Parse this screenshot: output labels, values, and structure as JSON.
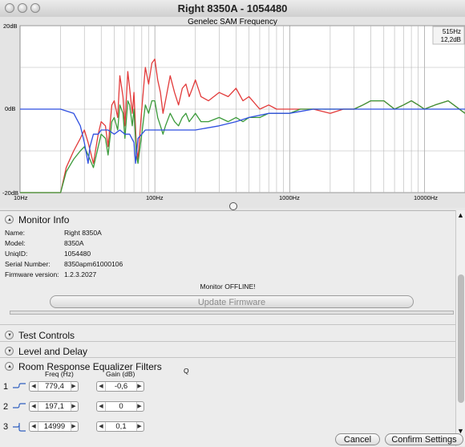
{
  "window": {
    "title": "Right 8350A - 1054480"
  },
  "chart": {
    "title": "Genelec SAM Frequency",
    "y_top_label": "20dB",
    "y_mid_label": "0dB",
    "y_bottom_label": "-20dB",
    "x_labels": [
      "10Hz",
      "100Hz",
      "1000Hz",
      "10000Hz"
    ],
    "cursor_freq": "515Hz",
    "cursor_gain": "12,2dB",
    "colors": {
      "red": "#e23a3a",
      "green": "#3a9a3a",
      "blue": "#2f4fe0",
      "brown": "#8a5a2a",
      "plot_bg": "#ffffff"
    }
  },
  "chart_data": {
    "type": "line",
    "xscale": "log",
    "xlim": [
      10,
      20000
    ],
    "ylim": [
      -20,
      20
    ],
    "x_tick_labels": [
      "10Hz",
      "100Hz",
      "1000Hz",
      "10000Hz"
    ],
    "y_tick_labels": [
      "20dB",
      "0dB",
      "-20dB"
    ],
    "series": [
      {
        "color": "red",
        "x": [
          10,
          16,
          20,
          22,
          25,
          28,
          30,
          32,
          35,
          38,
          40,
          43,
          45,
          48,
          50,
          53,
          55,
          58,
          60,
          63,
          65,
          68,
          70,
          73,
          75,
          80,
          85,
          90,
          95,
          100,
          105,
          110,
          115,
          120,
          130,
          140,
          150,
          160,
          170,
          180,
          190,
          200,
          220,
          250,
          300,
          350,
          400,
          450,
          500,
          600,
          700,
          800,
          1000,
          1200,
          1500,
          2000,
          2500,
          3000,
          3500,
          4000,
          5000,
          6000,
          7000,
          8000,
          9000,
          10000,
          12000,
          15000,
          20000
        ],
        "y": [
          -20,
          -20,
          -20,
          -14,
          -10,
          -7,
          -5,
          -8,
          -13,
          -6,
          -3,
          -4,
          -9,
          1,
          2,
          -2,
          8,
          3,
          -4,
          9,
          5,
          -1,
          4,
          -9,
          -12,
          0,
          10,
          6,
          11,
          12,
          7,
          4,
          -1,
          2,
          8,
          4,
          1,
          5,
          6,
          3,
          5,
          7,
          3,
          2,
          4,
          3,
          5,
          2,
          3,
          0,
          1,
          0,
          0,
          0,
          0,
          -1,
          0,
          0,
          1,
          2,
          2,
          0,
          1,
          2,
          1,
          0,
          1,
          2,
          -1
        ]
      },
      {
        "color": "green",
        "x": [
          10,
          16,
          20,
          22,
          25,
          28,
          30,
          32,
          35,
          38,
          40,
          43,
          45,
          48,
          50,
          53,
          55,
          58,
          60,
          63,
          65,
          68,
          70,
          73,
          75,
          80,
          85,
          90,
          95,
          100,
          105,
          110,
          115,
          120,
          130,
          140,
          150,
          160,
          170,
          180,
          190,
          200,
          220,
          250,
          300,
          350,
          400,
          450,
          500,
          600,
          700,
          800,
          1000,
          1200,
          1500,
          2000,
          2500,
          3000,
          3500,
          4000,
          5000,
          6000,
          7000,
          8000,
          9000,
          10000,
          12000,
          15000,
          20000
        ],
        "y": [
          -20,
          -20,
          -20,
          -15,
          -12,
          -10,
          -9,
          -11,
          -14,
          -9,
          -6,
          -7,
          -11,
          -3,
          -2,
          -5,
          1,
          -1,
          -7,
          2,
          1,
          -4,
          0,
          -11,
          -13,
          -6,
          1,
          -1,
          2,
          2,
          -2,
          -4,
          -6,
          -4,
          -1,
          -3,
          -4,
          -2,
          -1,
          -3,
          -2,
          -1,
          -3,
          -3,
          -2,
          -3,
          -2,
          -3,
          -2,
          -2,
          -1,
          -1,
          -1,
          0,
          0,
          0,
          0,
          0,
          1,
          2,
          2,
          0,
          1,
          2,
          1,
          0,
          1,
          2,
          -1
        ]
      },
      {
        "color": "blue",
        "x": [
          10,
          20,
          25,
          28,
          30,
          32,
          33,
          35,
          38,
          40,
          45,
          50,
          55,
          60,
          65,
          70,
          72,
          75,
          80,
          85,
          90,
          100,
          120,
          150,
          200,
          300,
          400,
          500,
          700,
          1000,
          1500,
          2000,
          3000,
          5000,
          10000,
          20000
        ],
        "y": [
          0,
          0,
          -1,
          -4,
          -8,
          -13,
          -9,
          -6,
          -6,
          -5,
          -5,
          -6,
          -5,
          -6,
          -6,
          -8,
          -13,
          -7,
          -6,
          -5,
          -5,
          -5,
          -5,
          -5,
          -5,
          -4,
          -3,
          -2,
          -1,
          -1,
          0,
          0,
          0,
          0,
          0,
          0
        ]
      }
    ]
  },
  "sections": {
    "monitor_info": "Monitor Info",
    "test_controls": "Test Controls",
    "level_delay": "Level and Delay",
    "room_eq": "Room Response Equalizer Filters"
  },
  "monitor_info": {
    "rows": [
      {
        "key": "Name:",
        "value": "Right 8350A"
      },
      {
        "key": "Model:",
        "value": "8350A"
      },
      {
        "key": "UniqID:",
        "value": "1054480"
      },
      {
        "key": "Serial Number:",
        "value": "8350apm61000106"
      },
      {
        "key": "Firmware version:",
        "value": "1.2.3.2027"
      }
    ],
    "status": "Monitor OFFLINE!",
    "update_label": "Update Firmware"
  },
  "eq": {
    "headers": {
      "freq": "Freq (Hz)",
      "gain": "Gain (dB)",
      "q": "Q"
    },
    "rows": [
      {
        "num": "1",
        "freq": "779,4",
        "gain": "-0,6"
      },
      {
        "num": "2",
        "freq": "197,1",
        "gain": "0"
      },
      {
        "num": "3",
        "freq": "14999",
        "gain": "0,1"
      }
    ]
  },
  "buttons": {
    "cancel": "Cancel",
    "confirm": "Confirm Settings"
  }
}
